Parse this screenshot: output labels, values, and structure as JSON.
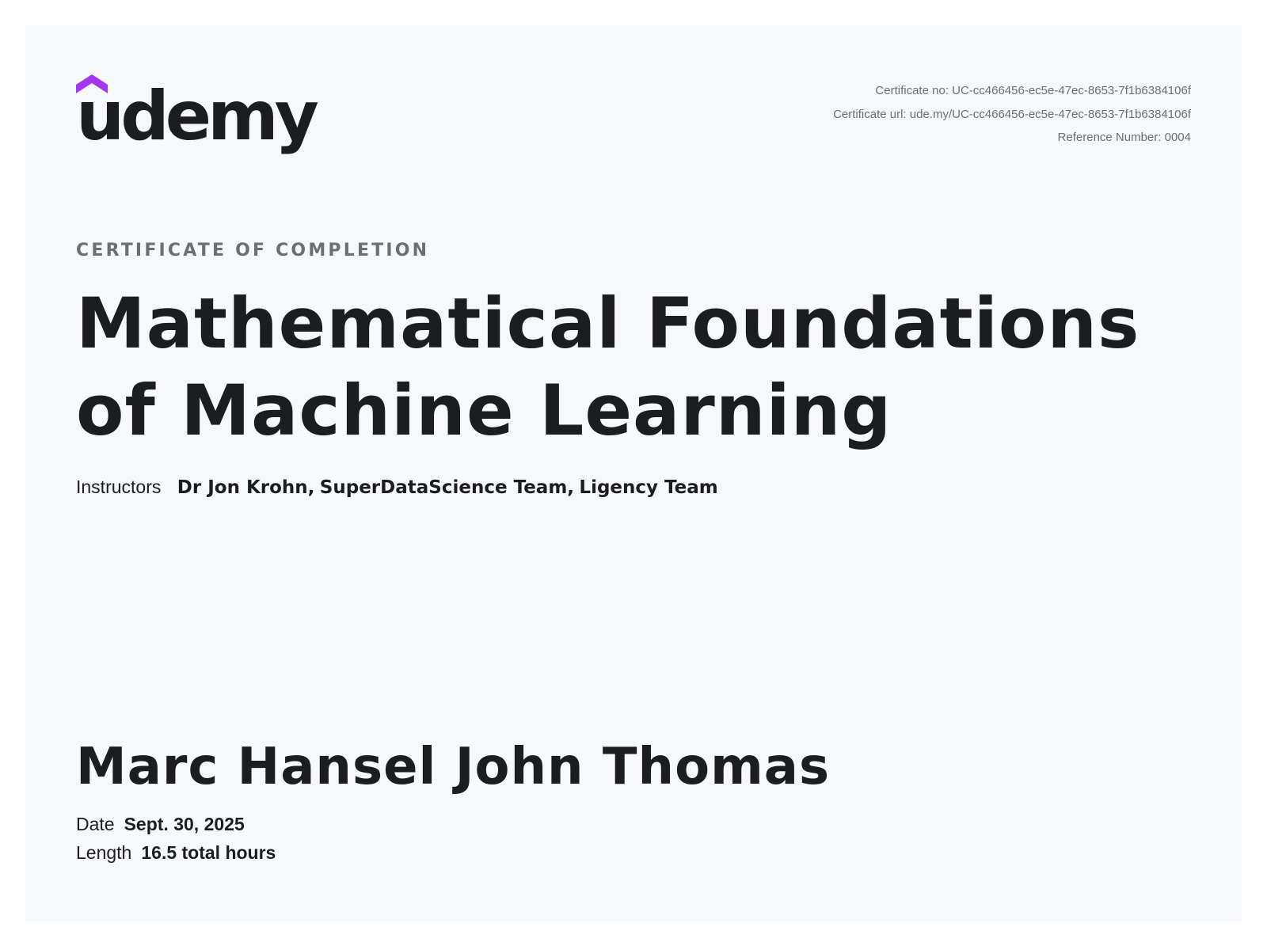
{
  "brand": {
    "logo_text": "udemy",
    "logo_icon": "udemy-hat-icon",
    "accent_color": "#a435f0"
  },
  "certificate_meta": {
    "certificate_no_label": "Certificate no:",
    "certificate_no": "UC-cc466456-ec5e-47ec-8653-7f1b6384106f",
    "certificate_url_label": "Certificate url:",
    "certificate_url": "ude.my/UC-cc466456-ec5e-47ec-8653-7f1b6384106f",
    "reference_label": "Reference Number:",
    "reference_number": "0004"
  },
  "kicker": "CERTIFICATE OF COMPLETION",
  "course": {
    "title_line1": "Mathematical Foundations",
    "title_line2": "of Machine Learning"
  },
  "instructors": {
    "label": "Instructors",
    "names": [
      "Dr Jon Krohn,",
      "SuperDataScience Team,",
      "Ligency Team"
    ]
  },
  "recipient": "Marc Hansel John Thomas",
  "details": {
    "date_label": "Date",
    "date_value": "Sept. 30, 2025",
    "length_label": "Length",
    "length_value": "16.5 total hours"
  }
}
